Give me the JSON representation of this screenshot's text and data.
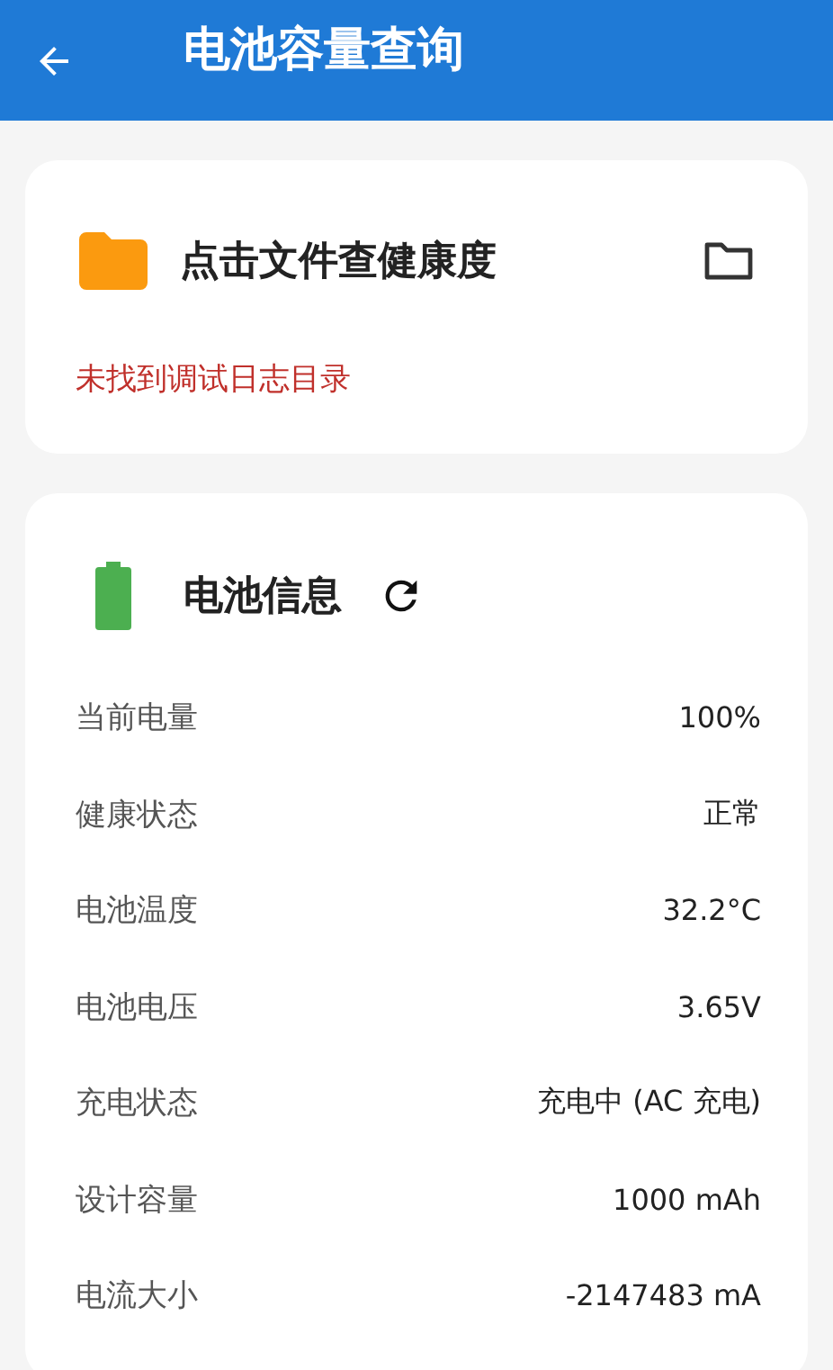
{
  "app_bar": {
    "title": "电池容量查询"
  },
  "file_card": {
    "title": "点击文件查健康度",
    "message": "未找到调试日志目录"
  },
  "battery_card": {
    "title": "电池信息",
    "rows": [
      {
        "label": "当前电量",
        "value": "100%"
      },
      {
        "label": "健康状态",
        "value": "正常"
      },
      {
        "label": "电池温度",
        "value": "32.2°C"
      },
      {
        "label": "电池电压",
        "value": "3.65V"
      },
      {
        "label": "充电状态",
        "value": "充电中 (AC 充电)"
      },
      {
        "label": "设计容量",
        "value": "1000 mAh"
      },
      {
        "label": "电流大小",
        "value": "-2147483 mA"
      }
    ]
  }
}
